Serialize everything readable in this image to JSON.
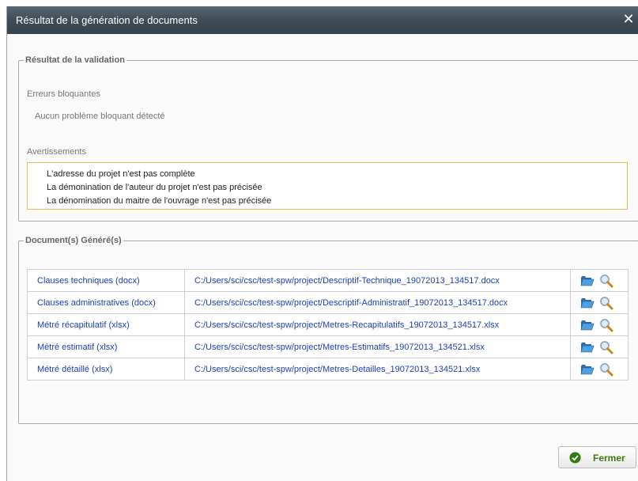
{
  "dialog": {
    "title": "Résultat de la génération de documents",
    "close_icon": "close-icon"
  },
  "validation": {
    "legend": "Résultat de la validation",
    "blocking_label": "Erreurs bloquantes",
    "blocking_text": "Aucun problème bloquant détecté",
    "warnings_label": "Avertissements",
    "warnings": [
      "L'adresse du projet n'est pas complète",
      "La démonination de l'auteur du projet n'est pas précisée",
      "La dénomination du maitre de l'ouvrage n'est pas précisée"
    ],
    "warning_border_color": "#f1b94a"
  },
  "generated": {
    "legend": "Document(s) Généré(s)",
    "rows": [
      {
        "name": "Clauses techniques (docx)",
        "path": "C:/Users/sci/csc/test-spw/project/Descriptif-Technique_19072013_134517.docx"
      },
      {
        "name": "Clauses administratives (docx)",
        "path": "C:/Users/sci/csc/test-spw/project/Descriptif-Administratif_19072013_134517.docx"
      },
      {
        "name": "Métré récapitulatif (xlsx)",
        "path": "C:/Users/sci/csc/test-spw/project/Metres-Recapitulatifs_19072013_134517.xlsx"
      },
      {
        "name": "Métré estimatif (xlsx)",
        "path": "C:/Users/sci/csc/test-spw/project/Metres-Estimatifs_19072013_134521.xlsx"
      },
      {
        "name": "Métré détaillé (xlsx)",
        "path": "C:/Users/sci/csc/test-spw/project/Metres-Detailles_19072013_134521.xlsx"
      }
    ],
    "row_icons": [
      "folder-open-icon",
      "search-icon"
    ],
    "link_color": "#1c3fb5"
  },
  "footer": {
    "close_label": "Fermer",
    "close_icon": "check-circle-icon"
  }
}
